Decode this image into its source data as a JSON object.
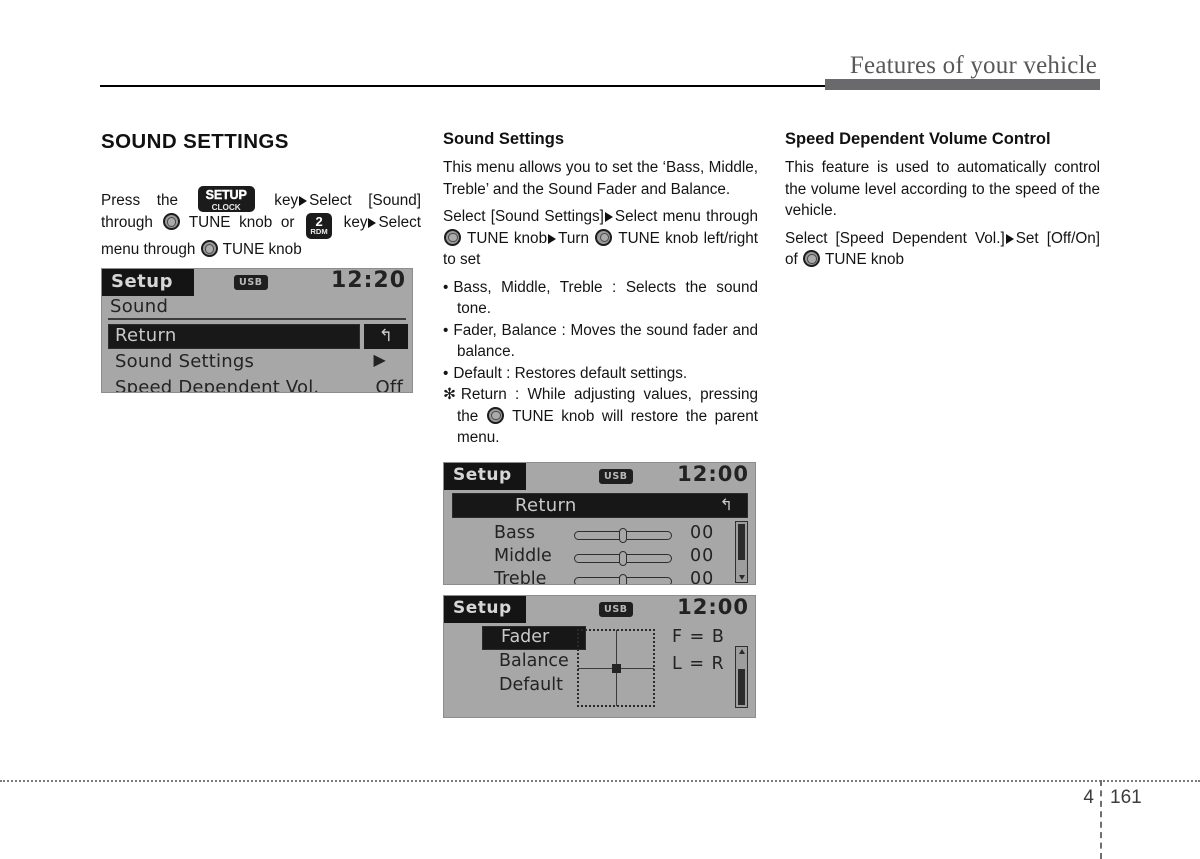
{
  "header": {
    "title": "Features of your vehicle"
  },
  "footer": {
    "chapter": "4",
    "page": "161"
  },
  "left": {
    "section_title": "SOUND SETTINGS",
    "instruction": {
      "p1": "Press  the",
      "setup_key": {
        "line1": "SETUP",
        "line2": "CLOCK"
      },
      "p2": "key",
      "p3": "Select  [Sound]",
      "p4": "through",
      "p5": "TUNE knob or",
      "rdm_key": {
        "line1": "2",
        "line2": "RDM"
      },
      "p6": "key",
      "p7": "Select",
      "p8": "menu through",
      "p9": "TUNE knob"
    },
    "lcd1": {
      "badge": "Setup",
      "usb": "USB",
      "clock": "12:20",
      "subtitle": "Sound",
      "rows": [
        {
          "label": "Return",
          "icon": "↰",
          "selected": true
        },
        {
          "label": "Sound Settings",
          "caret": "▶",
          "value": ""
        },
        {
          "label": "Speed Dependent Vol.",
          "value": "Off"
        }
      ]
    }
  },
  "middle": {
    "sub_title": "Sound Settings",
    "para1": "This menu allows you to set the ‘Bass, Middle, Treble’ and the Sound Fader and Balance.",
    "step": {
      "a": "Select  [Sound  Settings]",
      "b": "Select  menu through",
      "c": "TUNE  knob",
      "d": "Turn",
      "e": "TUNE knob left/right to set"
    },
    "bullets": [
      {
        "mark": "•",
        "text": "Bass, Middle, Treble : Selects the sound tone."
      },
      {
        "mark": "•",
        "text": "Fader, Balance : Moves the sound fader and balance."
      },
      {
        "mark": "•",
        "text": "Default : Restores default settings."
      }
    ],
    "note": {
      "mark": "✻",
      "a": "Return : While adjusting values, pressing the",
      "b": "TUNE  knob  will  restore  the parent menu."
    },
    "lcd2": {
      "badge": "Setup",
      "usb": "USB",
      "clock": "12:00",
      "selected_row": {
        "label": "Return",
        "icon": "↰"
      },
      "eq_rows": [
        {
          "name": "Bass",
          "value": "00"
        },
        {
          "name": "Middle",
          "value": "00"
        },
        {
          "name": "Treble",
          "value": "00"
        }
      ]
    },
    "lcd3": {
      "badge": "Setup",
      "usb": "USB",
      "clock": "12:00",
      "menu": [
        {
          "label": "Fader",
          "selected": true
        },
        {
          "label": "Balance",
          "selected": false
        },
        {
          "label": "Default",
          "selected": false
        }
      ],
      "fader_front_back": "F = B",
      "fader_left_right": "L = R"
    }
  },
  "right": {
    "sub_title": "Speed Dependent Volume Control",
    "para1": "This feature is used to automatically control the volume level according to the speed of the vehicle.",
    "step": {
      "a": "Select  [Speed  Dependent  Vol.]",
      "b": "Set [Off/On] of",
      "c": "TUNE knob"
    }
  }
}
